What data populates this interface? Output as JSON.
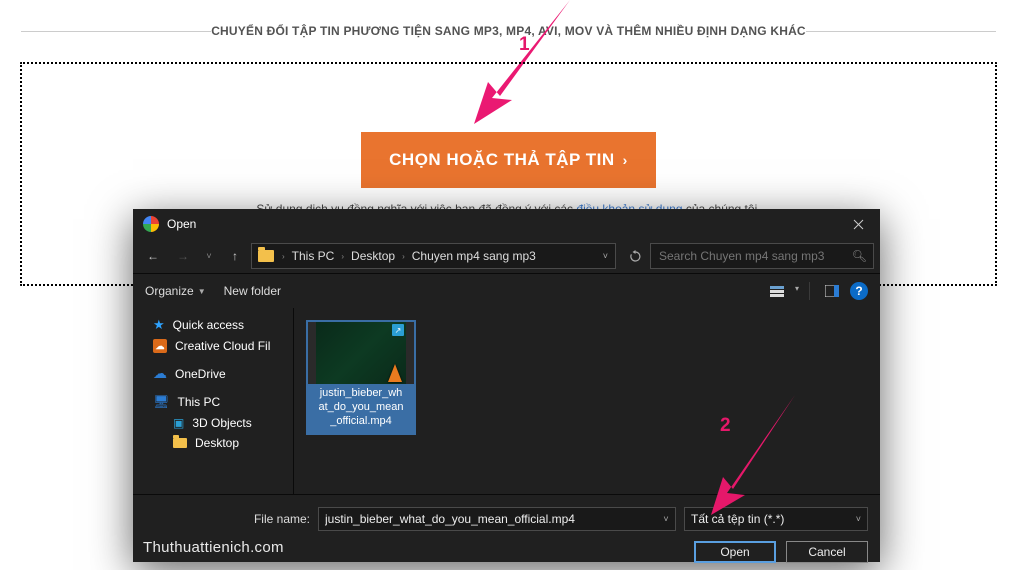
{
  "subtitle": "CHUYỂN ĐỔI TẬP TIN PHƯƠNG TIỆN SANG MP3, MP4, AVI, MOV VÀ THÊM NHIỀU ĐỊNH DẠNG KHÁC",
  "annotation": {
    "n1": "1",
    "n2": "2"
  },
  "choose_label": "CHỌN HOẶC THẢ TẬP TIN",
  "tos_pre": "Sử dụng dịch vụ đồng nghĩa với việc bạn đã đồng ý với các ",
  "tos_link": "điều khoản sử dụng",
  "tos_post": " của chúng tôi.",
  "dialog": {
    "title": "Open",
    "address": {
      "crumbs": [
        "This PC",
        "Desktop",
        "Chuyen mp4 sang mp3"
      ]
    },
    "search_placeholder": "Search Chuyen mp4 sang mp3",
    "toolbar": {
      "organize": "Organize",
      "new_folder": "New folder"
    },
    "sidebar": {
      "items": [
        {
          "label": "Quick access"
        },
        {
          "label": "Creative Cloud Fil"
        },
        {
          "label": "OneDrive"
        },
        {
          "label": "This PC"
        },
        {
          "label": "3D Objects"
        },
        {
          "label": "Desktop"
        }
      ]
    },
    "files": [
      {
        "label": "justin_bieber_what_do_you_mean_official.mp4"
      }
    ],
    "filelabel_wrapped": "justin_bieber_wh\nat_do_you_mean\n_official.mp4",
    "filename_label": "File name:",
    "filename_value": "justin_bieber_what_do_you_mean_official.mp4",
    "filetype": "Tất cả tệp tin (*.*)",
    "open": "Open",
    "cancel": "Cancel"
  },
  "watermark": "Thuthuattienich.com"
}
